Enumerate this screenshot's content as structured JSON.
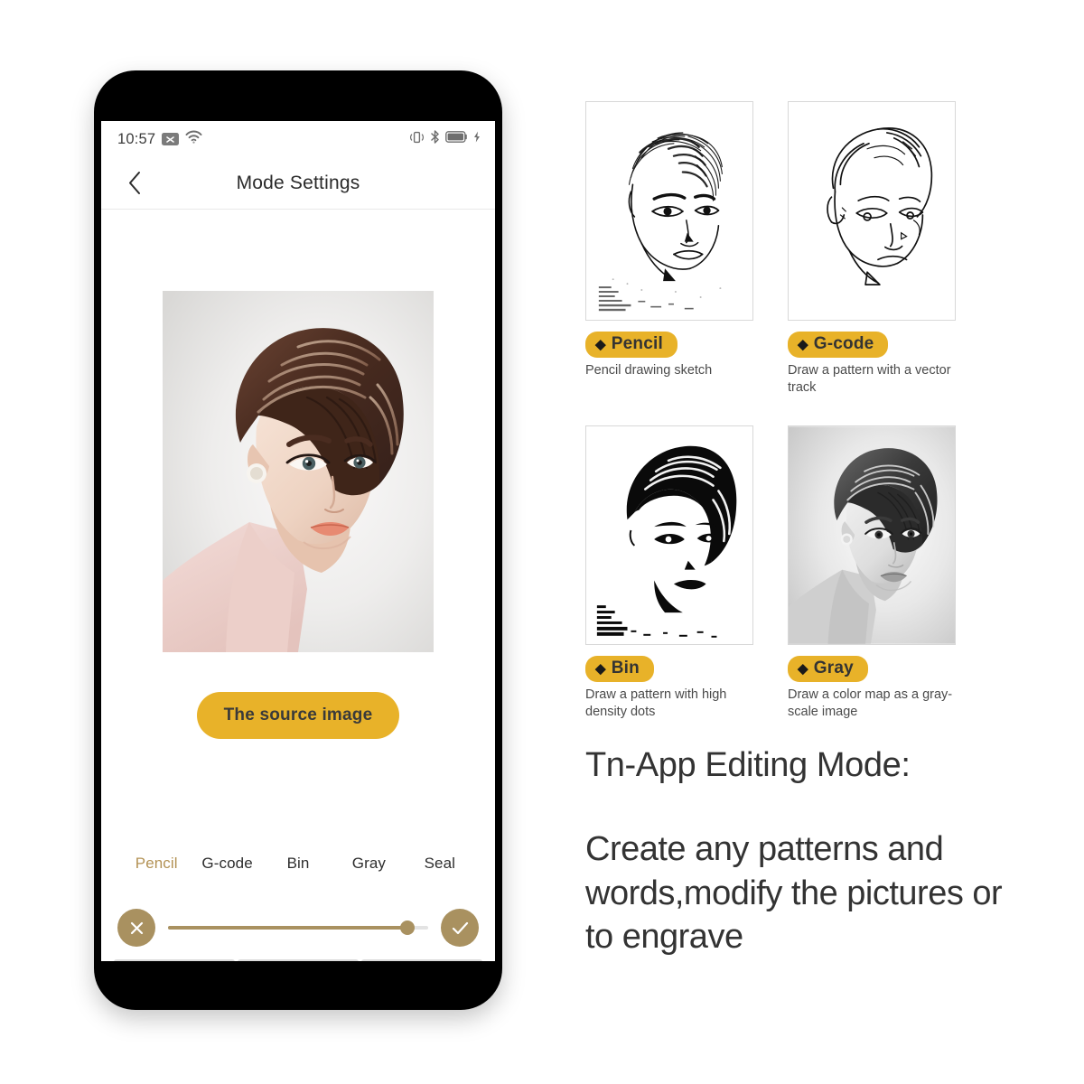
{
  "phone": {
    "status_bar": {
      "time": "10:57",
      "icons_left": [
        "sim-disabled-icon",
        "wifi-icon"
      ],
      "icons_right": [
        "vibrate-icon",
        "bluetooth-icon",
        "battery-icon",
        "charging-bolt-icon"
      ]
    },
    "nav": {
      "back_icon": "chevron-left-icon",
      "title": "Mode Settings"
    },
    "source_image": {
      "alt": "Colorized portrait photograph of a woman"
    },
    "source_button_label": "The source image",
    "mode_tabs": [
      {
        "label": "Pencil",
        "active": true
      },
      {
        "label": "G-code",
        "active": false
      },
      {
        "label": "Bin",
        "active": false
      },
      {
        "label": "Gray",
        "active": false
      },
      {
        "label": "Seal",
        "active": false
      }
    ],
    "slider": {
      "cancel_icon": "close-icon",
      "confirm_icon": "check-icon",
      "value_percent": 92
    }
  },
  "modes_grid": [
    {
      "name": "Pencil",
      "badge_bullet": "◆",
      "description": "Pencil drawing sketch",
      "thumb": "pencil-sketch-thumbnail"
    },
    {
      "name": "G-code",
      "badge_bullet": "◆",
      "description": "Draw a pattern with a vector track",
      "thumb": "gcode-vector-thumbnail"
    },
    {
      "name": "Bin",
      "badge_bullet": "◆",
      "description": "Draw a pattern with high density dots",
      "thumb": "bin-halftone-thumbnail"
    },
    {
      "name": "Gray",
      "badge_bullet": "◆",
      "description": "Draw a color map as a gray-scale image",
      "thumb": "grayscale-thumbnail"
    }
  ],
  "marketing": {
    "headline": "Tn-App Editing Mode:",
    "body": "Create any patterns and words,modify the pictures or to engrave"
  },
  "colors": {
    "accent_yellow": "#E8B229",
    "accent_gold": "#A99160",
    "active_tab": "#B39255",
    "text_dark": "#333333"
  }
}
